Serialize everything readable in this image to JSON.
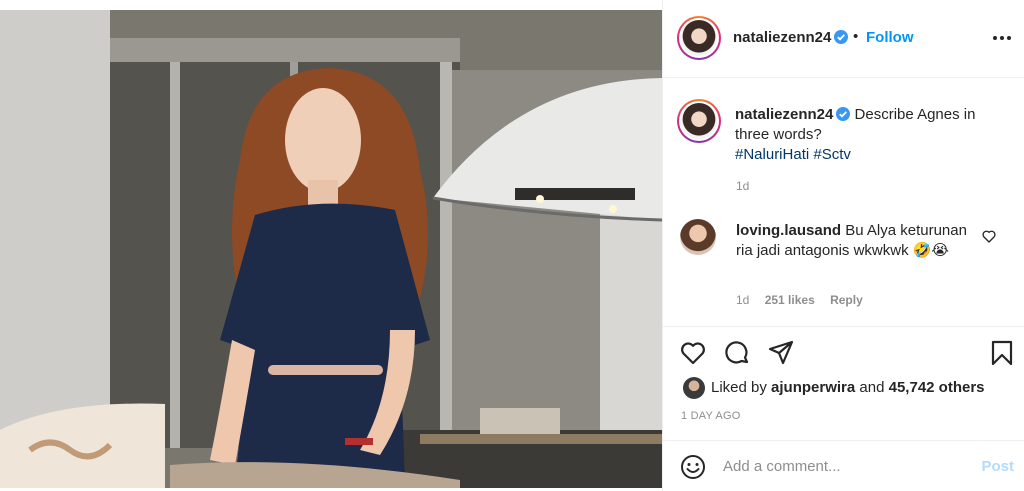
{
  "post": {
    "author": "nataliezenn24",
    "follow_label": "Follow",
    "caption": "Describe Agnes in three words?",
    "hashtags": [
      "#NaluriHati",
      "#Sctv"
    ],
    "caption_time": "1d"
  },
  "comment": {
    "author": "loving.lausand",
    "text": "Bu Alya keturunan ria jadi antagonis wkwkwk 🤣😭",
    "time": "1d",
    "likes": "251 likes",
    "reply_label": "Reply"
  },
  "likes": {
    "prefix": "Liked by",
    "user": "ajunperwira",
    "conjunction": "and",
    "others": "45,742 others"
  },
  "post_time": "1 DAY AGO",
  "composer": {
    "placeholder": "Add a comment...",
    "post_label": "Post"
  },
  "icons": {
    "verified": "verified-badge-icon",
    "more": "more-options-icon",
    "like": "heart-icon",
    "comment": "comment-bubble-icon",
    "share": "paper-plane-icon",
    "save": "bookmark-icon",
    "emoji": "smiley-icon"
  },
  "colors": {
    "link_blue": "#0095f6",
    "hashtag": "#00376b",
    "muted": "#8e8e8e",
    "post_disabled": "#b3dbff"
  }
}
